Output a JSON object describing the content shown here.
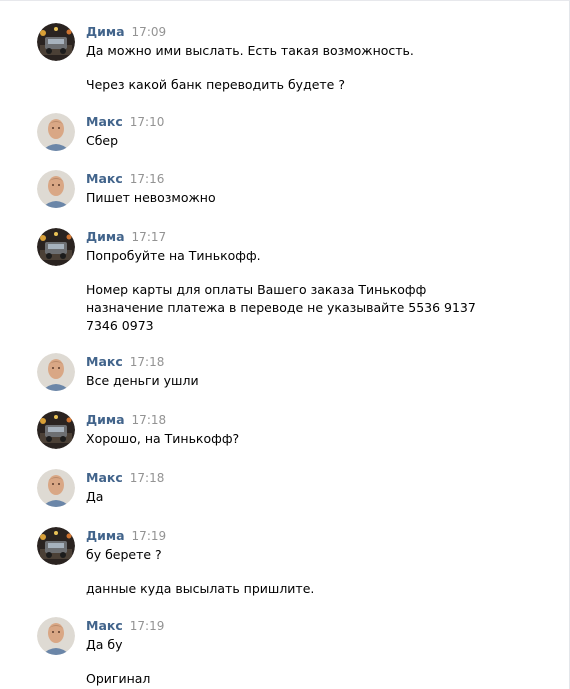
{
  "colors": {
    "name": "#42648b",
    "time": "#939393",
    "text": "#000000"
  },
  "messages": [
    {
      "author": "Дима",
      "time": "17:09",
      "avatar": "dima",
      "lines": [
        "Да можно ими выслать. Есть такая возможность.",
        "",
        "Через какой банк переводить будете ?"
      ]
    },
    {
      "author": "Макс",
      "time": "17:10",
      "avatar": "maks",
      "lines": [
        "Сбер"
      ]
    },
    {
      "author": "Макс",
      "time": "17:16",
      "avatar": "maks",
      "lines": [
        "Пишет невозможно"
      ]
    },
    {
      "author": "Дима",
      "time": "17:17",
      "avatar": "dima",
      "lines": [
        "Попробуйте на Тинькофф.",
        "",
        "Номер карты для оплаты Вашего заказа Тинькофф",
        "назначение платежа в переводе не указывайте 5536 9137",
        "7346 0973"
      ]
    },
    {
      "author": "Макс",
      "time": "17:18",
      "avatar": "maks",
      "lines": [
        "Все деньги ушли"
      ]
    },
    {
      "author": "Дима",
      "time": "17:18",
      "avatar": "dima",
      "lines": [
        "Хорошо, на Тинькофф?"
      ]
    },
    {
      "author": "Макс",
      "time": "17:18",
      "avatar": "maks",
      "lines": [
        "Да"
      ]
    },
    {
      "author": "Дима",
      "time": "17:19",
      "avatar": "dima",
      "lines": [
        "бу берете ?",
        "",
        "данные куда высылать пришлите."
      ]
    },
    {
      "author": "Макс",
      "time": "17:19",
      "avatar": "maks",
      "lines": [
        "Да бу",
        "",
        "Оригинал"
      ]
    }
  ]
}
